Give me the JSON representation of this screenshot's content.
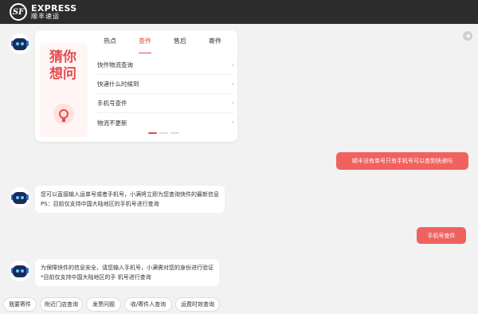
{
  "header": {
    "logo_mark": "SF",
    "logo_en": "EXPRESS",
    "logo_cn": "顺丰速运"
  },
  "faq_card": {
    "tabs": [
      "热点",
      "查件",
      "售后",
      "寄件"
    ],
    "active_tab": "查件",
    "banner": "猜你想问",
    "items": [
      "快件物流查询",
      "快递什么时候到",
      "手机号查件",
      "物流不更新"
    ],
    "page_count": 3,
    "active_page": 1
  },
  "messages": [
    {
      "from": "user",
      "text": "顺丰没有单号只有手机号可以查到快递吗"
    },
    {
      "from": "bot",
      "lines": [
        "您可以直接输入运单号或者手机号，小满将立即为您查询快件的最新信息",
        "PS：目前仅支持中国大陆地区的手机号进行查询"
      ]
    },
    {
      "from": "user",
      "text": "手机号查件"
    },
    {
      "from": "bot",
      "lines": [
        "为保障快件的信息安全，请您输入手机号，小满需对您的身份进行验证",
        "*目前仅支持中国大陆地区的手 机号进行查询"
      ]
    }
  ],
  "quick_replies": [
    "我要寄件",
    "附近门店查询",
    "发票问题",
    "收/寄件人查询",
    "运费时效查询"
  ],
  "colors": {
    "accent": "#f0625f",
    "header_bg": "#2c2c2c",
    "chat_bg": "#f2f2f2"
  }
}
